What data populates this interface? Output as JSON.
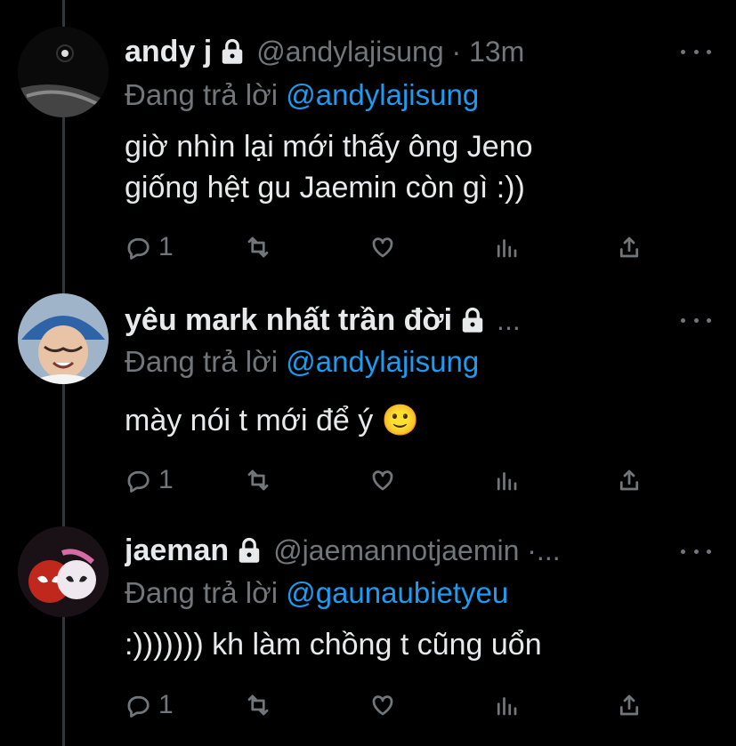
{
  "tweets": [
    {
      "name": "andy j",
      "handle": "@andylajisung · 13m",
      "reply_prefix": "Đang trả lời",
      "reply_mention": "@andylajisung",
      "text_lines": [
        "giờ nhìn lại mới thấy ông Jeno",
        "giống hệt gu Jaemin còn gì :))"
      ],
      "reply_count": "1"
    },
    {
      "name": "yêu mark nhất trần đời",
      "handle": "...",
      "reply_prefix": "Đang trả lời",
      "reply_mention": "@andylajisung",
      "text_lines": [
        "mày nói t mới để ý 🙂"
      ],
      "reply_count": "1"
    },
    {
      "name": "jaeman",
      "handle": "@jaemannotjaemin ·...",
      "reply_prefix": "Đang trả lời",
      "reply_mention": "@gaunaubietyeu",
      "text_lines": [
        ":))))))) kh làm chồng t cũng uổn"
      ],
      "reply_count": "1"
    }
  ],
  "icons": {
    "lock": "lock-icon",
    "more": "more-icon",
    "reply": "reply-icon",
    "retweet": "retweet-icon",
    "like": "heart-icon",
    "analytics": "analytics-icon",
    "share": "share-icon"
  },
  "colors": {
    "background": "#000000",
    "text": "#e7e9ea",
    "muted": "#71767b",
    "mention": "#1d9bf0"
  }
}
